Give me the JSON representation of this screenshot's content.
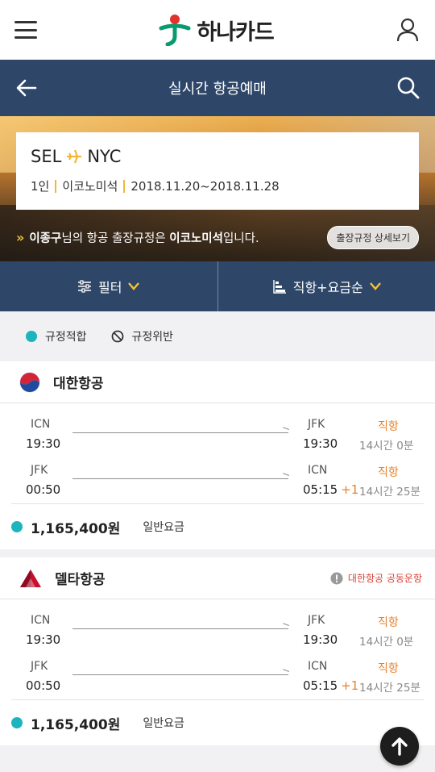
{
  "brand": {
    "name": "하나카드"
  },
  "navbar": {
    "title": "실시간 항공예매"
  },
  "route": {
    "origin": "SEL",
    "destination": "NYC",
    "passengers": "1인",
    "cabin": "이코노미석",
    "dates": "2018.11.20~2018.11.28"
  },
  "policy": {
    "name": "이종구",
    "text_mid": "님의 항공 출장규정은 ",
    "class": "이코노미석",
    "text_end": "입니다.",
    "button_label": "출장규정 상세보기"
  },
  "filters": {
    "filter_label": "필터",
    "sort_label": "직항+요금순"
  },
  "legend": {
    "compliant": "규정적합",
    "violation": "규정위반"
  },
  "colors": {
    "navy": "#2e4769",
    "teal": "#1cb5be",
    "orange": "#e6812a",
    "red": "#d9443a"
  },
  "flights": [
    {
      "airline": "대한항공",
      "logo": "korean-air-logo",
      "codeshare": "",
      "legs": [
        {
          "dep_code": "ICN",
          "dep_time": "19:30",
          "arr_code": "JFK",
          "arr_time": "19:30",
          "day_offset": "",
          "type": "직항",
          "duration": "14시간 0분"
        },
        {
          "dep_code": "JFK",
          "dep_time": "00:50",
          "arr_code": "ICN",
          "arr_time": "05:15",
          "day_offset": "+1",
          "type": "직항",
          "duration": "14시간 25분"
        }
      ],
      "price": "1,165,400원",
      "fare_type": "일반요금"
    },
    {
      "airline": "델타항공",
      "logo": "delta-logo",
      "codeshare": "대한항공 공동운항",
      "legs": [
        {
          "dep_code": "ICN",
          "dep_time": "19:30",
          "arr_code": "JFK",
          "arr_time": "19:30",
          "day_offset": "",
          "type": "직항",
          "duration": "14시간 0분"
        },
        {
          "dep_code": "JFK",
          "dep_time": "00:50",
          "arr_code": "ICN",
          "arr_time": "05:15",
          "day_offset": "+1",
          "type": "직항",
          "duration": "14시간 25분"
        }
      ],
      "price": "1,165,400원",
      "fare_type": "일반요금"
    }
  ]
}
